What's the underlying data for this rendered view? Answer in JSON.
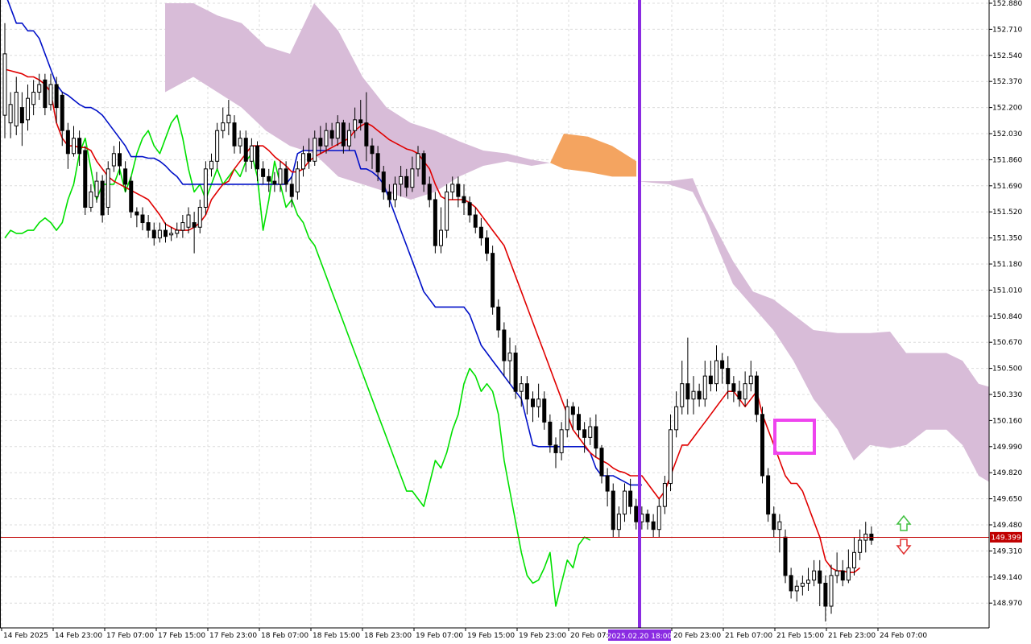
{
  "chart_data": {
    "type": "candlestick",
    "instrument_timeframe": "H2",
    "grid": true,
    "ylim": [
      148.885,
      152.88
    ],
    "y_ticks": [
      "152.880",
      "152.710",
      "152.540",
      "152.370",
      "152.200",
      "152.030",
      "151.860",
      "151.690",
      "151.520",
      "151.350",
      "151.180",
      "151.010",
      "150.840",
      "150.670",
      "150.500",
      "150.330",
      "150.160",
      "149.990",
      "149.820",
      "149.650",
      "149.480",
      "149.310",
      "149.140",
      "148.970"
    ],
    "x_ticks": [
      "14 Feb 2025",
      "14 Feb 23:00",
      "17 Feb 07:00",
      "17 Feb 15:00",
      "17 Feb 23:00",
      "18 Feb 07:00",
      "18 Feb 15:00",
      "18 Feb 23:00",
      "19 Feb 07:00",
      "19 Feb 15:00",
      "19 Feb 23:00",
      "20 Feb 07:00",
      "20 Feb 23:00",
      "21 Feb 07:00",
      "21 Feb 15:00",
      "21 Feb 23:00",
      "24 Feb 07:00"
    ],
    "current_price": "149.399",
    "vline_label": "2025.02.20 18:00",
    "colors": {
      "tenkan": "#e00000",
      "kijun": "#0010c8",
      "chikou": "#00e000",
      "cloud_bear": "#d8bcd8",
      "cloud_bull": "#f4a460",
      "vline": "#8a2be2",
      "price_line": "#c00000",
      "highlight_box": "#ee44ee",
      "arrow_up": "#40c040",
      "arrow_down": "#e03030"
    },
    "candles": [
      [
        152.15,
        152.55,
        152.0,
        152.75
      ],
      [
        152.1,
        152.22,
        152.0,
        152.3
      ],
      [
        152.08,
        152.3,
        152.02,
        152.4
      ],
      [
        152.2,
        152.1,
        151.95,
        152.3
      ],
      [
        152.12,
        152.26,
        152.05,
        152.35
      ],
      [
        152.22,
        152.3,
        152.15,
        152.38
      ],
      [
        152.3,
        152.35,
        152.25,
        152.42
      ],
      [
        152.38,
        152.2,
        152.15,
        152.42
      ],
      [
        152.22,
        152.35,
        152.18,
        152.42
      ],
      [
        152.35,
        152.2,
        152.1,
        152.4
      ],
      [
        152.28,
        152.05,
        151.95,
        152.3
      ],
      [
        152.05,
        151.9,
        151.8,
        152.1
      ],
      [
        151.9,
        152.0,
        151.88,
        152.08
      ],
      [
        152.0,
        151.9,
        151.82,
        152.05
      ],
      [
        151.92,
        151.55,
        151.5,
        151.95
      ],
      [
        151.55,
        151.65,
        151.52,
        151.7
      ],
      [
        151.62,
        151.72,
        151.58,
        151.78
      ],
      [
        151.72,
        151.5,
        151.45,
        151.76
      ],
      [
        151.55,
        151.8,
        151.5,
        151.85
      ],
      [
        151.82,
        151.9,
        151.78,
        151.95
      ],
      [
        151.9,
        151.82,
        151.76,
        151.98
      ],
      [
        151.8,
        151.7,
        151.65,
        151.85
      ],
      [
        151.72,
        151.52,
        151.48,
        151.75
      ],
      [
        151.52,
        151.5,
        151.42,
        151.55
      ],
      [
        151.5,
        151.45,
        151.4,
        151.55
      ],
      [
        151.45,
        151.4,
        151.35,
        151.5
      ],
      [
        151.4,
        151.35,
        151.3,
        151.45
      ],
      [
        151.35,
        151.4,
        151.32,
        151.45
      ],
      [
        151.4,
        151.36,
        151.32,
        151.45
      ],
      [
        151.37,
        151.38,
        151.33,
        151.42
      ],
      [
        151.38,
        151.4,
        151.35,
        151.45
      ],
      [
        151.4,
        151.45,
        151.35,
        151.5
      ],
      [
        151.42,
        151.5,
        151.38,
        151.55
      ],
      [
        151.45,
        151.42,
        151.25,
        151.52
      ],
      [
        151.42,
        151.55,
        151.38,
        151.6
      ],
      [
        151.55,
        151.8,
        151.5,
        151.85
      ],
      [
        151.8,
        151.85,
        151.75,
        151.9
      ],
      [
        151.85,
        152.05,
        151.8,
        152.1
      ],
      [
        152.05,
        152.1,
        152.0,
        152.2
      ],
      [
        152.1,
        152.15,
        152.02,
        152.25
      ],
      [
        152.1,
        151.95,
        151.9,
        152.15
      ],
      [
        151.95,
        152.0,
        151.9,
        152.05
      ],
      [
        152.0,
        151.85,
        151.78,
        152.05
      ],
      [
        151.85,
        151.95,
        151.8,
        152.0
      ],
      [
        151.95,
        151.8,
        151.72,
        151.98
      ],
      [
        151.8,
        151.75,
        151.7,
        151.85
      ],
      [
        151.75,
        151.72,
        151.65,
        151.8
      ],
      [
        151.72,
        151.7,
        151.65,
        151.78
      ],
      [
        151.7,
        151.8,
        151.65,
        151.85
      ],
      [
        151.8,
        151.7,
        151.65,
        151.85
      ],
      [
        151.7,
        151.62,
        151.55,
        151.75
      ],
      [
        151.65,
        151.8,
        151.6,
        151.85
      ],
      [
        151.8,
        151.9,
        151.75,
        151.95
      ],
      [
        151.9,
        151.85,
        151.8,
        152.0
      ],
      [
        151.85,
        152.0,
        151.82,
        152.05
      ],
      [
        152.0,
        151.95,
        151.9,
        152.08
      ],
      [
        151.95,
        152.05,
        151.9,
        152.1
      ],
      [
        152.05,
        152.0,
        151.95,
        152.1
      ],
      [
        152.0,
        152.1,
        151.95,
        152.15
      ],
      [
        152.1,
        151.95,
        151.9,
        152.12
      ],
      [
        151.95,
        152.05,
        151.92,
        152.1
      ],
      [
        152.05,
        152.12,
        152.0,
        152.2
      ],
      [
        152.12,
        152.1,
        152.05,
        152.25
      ],
      [
        152.1,
        151.95,
        151.85,
        152.3
      ],
      [
        151.95,
        151.9,
        151.8,
        152.0
      ],
      [
        151.9,
        151.78,
        151.72,
        151.95
      ],
      [
        151.78,
        151.65,
        151.6,
        151.82
      ],
      [
        151.65,
        151.6,
        151.55,
        151.7
      ],
      [
        151.6,
        151.7,
        151.55,
        151.75
      ],
      [
        151.7,
        151.75,
        151.62,
        151.82
      ],
      [
        151.75,
        151.68,
        151.62,
        151.8
      ],
      [
        151.68,
        151.8,
        151.65,
        151.88
      ],
      [
        151.8,
        151.9,
        151.75,
        151.95
      ],
      [
        151.9,
        151.7,
        151.65,
        151.92
      ],
      [
        151.7,
        151.6,
        151.55,
        151.75
      ],
      [
        151.6,
        151.3,
        151.25,
        151.65
      ],
      [
        151.3,
        151.4,
        151.25,
        151.55
      ],
      [
        151.4,
        151.65,
        151.35,
        151.7
      ],
      [
        151.65,
        151.7,
        151.6,
        151.75
      ],
      [
        151.7,
        151.62,
        151.55,
        151.75
      ],
      [
        151.62,
        151.58,
        151.5,
        151.7
      ],
      [
        151.58,
        151.5,
        151.45,
        151.62
      ],
      [
        151.5,
        151.42,
        151.38,
        151.55
      ],
      [
        151.42,
        151.35,
        151.3,
        151.48
      ],
      [
        151.35,
        151.25,
        151.2,
        151.4
      ],
      [
        151.25,
        150.9,
        150.85,
        151.3
      ],
      [
        150.9,
        150.75,
        150.7,
        150.95
      ],
      [
        150.75,
        150.55,
        150.45,
        150.8
      ],
      [
        150.55,
        150.6,
        150.4,
        150.7
      ],
      [
        150.6,
        150.35,
        150.3,
        150.65
      ],
      [
        150.35,
        150.4,
        150.25,
        150.45
      ],
      [
        150.4,
        150.3,
        150.2,
        150.45
      ],
      [
        150.3,
        150.25,
        150.15,
        150.35
      ],
      [
        150.25,
        150.3,
        150.18,
        150.4
      ],
      [
        150.3,
        150.15,
        150.1,
        150.35
      ],
      [
        150.15,
        150.0,
        149.95,
        150.2
      ],
      [
        150.0,
        149.95,
        149.85,
        150.05
      ],
      [
        149.95,
        150.1,
        149.9,
        150.15
      ],
      [
        150.1,
        150.25,
        150.05,
        150.3
      ],
      [
        150.25,
        150.2,
        150.1,
        150.28
      ],
      [
        150.2,
        150.1,
        150.05,
        150.25
      ],
      [
        150.1,
        150.05,
        149.95,
        150.15
      ],
      [
        150.05,
        150.12,
        150.0,
        150.18
      ],
      [
        150.12,
        149.98,
        149.92,
        150.2
      ],
      [
        149.98,
        149.8,
        149.75,
        150.0
      ],
      [
        149.8,
        149.7,
        149.6,
        149.85
      ],
      [
        149.7,
        149.45,
        149.4,
        149.75
      ],
      [
        149.45,
        149.55,
        149.4,
        149.6
      ],
      [
        149.55,
        149.7,
        149.5,
        149.75
      ],
      [
        149.7,
        149.6,
        149.55,
        149.78
      ],
      [
        149.6,
        149.5,
        149.45,
        149.65
      ],
      [
        149.5,
        149.55,
        149.45,
        149.6
      ],
      [
        149.55,
        149.5,
        149.45,
        149.58
      ],
      [
        149.5,
        149.45,
        149.4,
        149.55
      ],
      [
        149.45,
        149.6,
        149.4,
        149.65
      ],
      [
        149.6,
        149.75,
        149.55,
        149.8
      ],
      [
        149.75,
        150.1,
        149.7,
        150.2
      ],
      [
        150.1,
        150.25,
        150.05,
        150.35
      ],
      [
        150.25,
        150.4,
        150.2,
        150.55
      ],
      [
        150.4,
        150.3,
        150.2,
        150.7
      ],
      [
        150.3,
        150.35,
        150.2,
        150.45
      ],
      [
        150.35,
        150.3,
        150.25,
        150.4
      ],
      [
        150.3,
        150.45,
        150.25,
        150.55
      ],
      [
        150.45,
        150.4,
        150.35,
        150.55
      ],
      [
        150.4,
        150.55,
        150.35,
        150.65
      ],
      [
        150.55,
        150.5,
        150.4,
        150.6
      ],
      [
        150.5,
        150.4,
        150.3,
        150.58
      ],
      [
        150.4,
        150.35,
        150.28,
        150.45
      ],
      [
        150.35,
        150.3,
        150.25,
        150.42
      ],
      [
        150.3,
        150.4,
        150.25,
        150.48
      ],
      [
        150.4,
        150.45,
        150.35,
        150.55
      ],
      [
        150.45,
        150.2,
        150.15,
        150.48
      ],
      [
        150.2,
        149.8,
        149.75,
        150.25
      ],
      [
        149.8,
        149.55,
        149.5,
        149.85
      ],
      [
        149.55,
        149.45,
        149.4,
        149.6
      ],
      [
        149.45,
        149.5,
        149.3,
        149.55
      ],
      [
        149.4,
        149.15,
        149.1,
        149.45
      ],
      [
        149.15,
        149.05,
        149.0,
        149.2
      ],
      [
        149.05,
        149.08,
        148.98,
        149.12
      ],
      [
        149.08,
        149.1,
        149.02,
        149.15
      ],
      [
        149.1,
        149.12,
        149.05,
        149.2
      ],
      [
        149.12,
        149.18,
        149.08,
        149.25
      ],
      [
        149.18,
        149.1,
        148.95,
        149.25
      ],
      [
        149.1,
        148.95,
        148.85,
        149.15
      ],
      [
        148.95,
        149.15,
        148.9,
        149.22
      ],
      [
        149.15,
        149.18,
        149.1,
        149.3
      ],
      [
        149.18,
        149.12,
        149.08,
        149.25
      ],
      [
        149.12,
        149.2,
        149.1,
        149.32
      ],
      [
        149.2,
        149.3,
        149.15,
        149.4
      ],
      [
        149.3,
        149.38,
        149.25,
        149.45
      ],
      [
        149.38,
        149.42,
        149.3,
        149.5
      ],
      [
        149.42,
        149.38,
        149.35,
        149.47
      ]
    ],
    "tenkan": [
      152.45,
      152.44,
      152.43,
      152.42,
      152.4,
      152.4,
      152.38,
      152.35,
      152.3,
      152.1,
      152.0,
      151.95,
      151.95,
      151.94,
      151.94,
      151.92,
      151.85,
      151.8,
      151.75,
      151.72,
      151.7,
      151.68,
      151.66,
      151.64,
      151.62,
      151.6,
      151.55,
      151.5,
      151.44,
      151.42,
      151.4,
      151.4,
      151.4,
      151.42,
      151.45,
      151.5,
      151.6,
      151.65,
      151.7,
      151.72,
      151.8,
      151.85,
      151.9,
      151.95,
      151.95,
      151.95,
      151.92,
      151.88,
      151.85,
      151.82,
      151.78,
      151.78,
      151.8,
      151.85,
      151.88,
      151.9,
      151.92,
      151.94,
      151.96,
      151.98,
      152.0,
      152.05,
      152.08,
      152.1,
      152.08,
      152.05,
      152.02,
      151.99,
      151.97,
      151.95,
      151.93,
      151.92,
      151.9,
      151.85,
      151.8,
      151.7,
      151.62,
      151.6,
      151.6,
      151.6,
      151.6,
      151.58,
      151.55,
      151.5,
      151.45,
      151.4,
      151.35,
      151.3,
      151.2,
      151.1,
      151.0,
      150.9,
      150.8,
      150.7,
      150.6,
      150.5,
      150.4,
      150.3,
      150.2,
      150.1,
      150.05,
      150.0,
      149.95,
      149.92,
      149.9,
      149.88,
      149.85,
      149.83,
      149.82,
      149.8,
      149.8,
      149.8,
      149.75,
      149.7,
      149.65,
      149.7,
      149.8,
      149.9,
      150.0,
      150.0,
      150.05,
      150.1,
      150.15,
      150.2,
      150.25,
      150.3,
      150.35,
      150.35,
      150.3,
      150.25,
      150.3,
      150.35,
      150.2,
      150.1,
      150.0,
      149.9,
      149.8,
      149.75,
      149.75,
      149.7,
      149.6,
      149.5,
      149.4,
      149.25,
      149.2,
      149.18,
      149.18,
      149.17,
      149.17,
      149.2
    ],
    "kijun": [
      152.95,
      152.85,
      152.75,
      152.75,
      152.7,
      152.7,
      152.65,
      152.55,
      152.45,
      152.35,
      152.3,
      152.28,
      152.25,
      152.22,
      152.2,
      152.2,
      152.18,
      152.15,
      152.1,
      152.05,
      152.0,
      151.95,
      151.88,
      151.88,
      151.88,
      151.87,
      151.87,
      151.85,
      151.82,
      151.78,
      151.75,
      151.7,
      151.7,
      151.7,
      151.7,
      151.7,
      151.7,
      151.7,
      151.7,
      151.7,
      151.7,
      151.7,
      151.7,
      151.7,
      151.7,
      151.7,
      151.7,
      151.7,
      151.7,
      151.7,
      151.75,
      151.9,
      151.92,
      151.92,
      151.92,
      151.92,
      151.92,
      151.92,
      151.92,
      151.92,
      151.92,
      151.92,
      151.8,
      151.8,
      151.78,
      151.75,
      151.7,
      151.6,
      151.5,
      151.4,
      151.3,
      151.2,
      151.1,
      151.0,
      150.95,
      150.9,
      150.9,
      150.9,
      150.9,
      150.9,
      150.9,
      150.85,
      150.75,
      150.65,
      150.6,
      150.55,
      150.5,
      150.45,
      150.4,
      150.35,
      150.3,
      150.15,
      150.0,
      149.99,
      149.99,
      149.99,
      149.99,
      149.99,
      149.99,
      149.99,
      149.99,
      149.99,
      149.95,
      149.85,
      149.8,
      149.8,
      149.8,
      149.78,
      149.76,
      149.74,
      149.74,
      149.74
    ],
    "chikou": [
      151.35,
      151.4,
      151.38,
      151.38,
      151.4,
      151.4,
      151.45,
      151.48,
      151.45,
      151.4,
      151.45,
      151.6,
      151.7,
      151.9,
      152.0,
      151.8,
      151.6,
      151.7,
      151.7,
      151.7,
      151.8,
      151.65,
      151.75,
      151.9,
      152.0,
      152.05,
      151.95,
      151.9,
      152.0,
      152.1,
      152.15,
      152.0,
      151.8,
      151.65,
      151.7,
      151.6,
      151.7,
      151.8,
      151.7,
      151.75,
      151.8,
      151.75,
      151.85,
      151.9,
      151.75,
      151.4,
      151.6,
      151.85,
      151.7,
      151.55,
      151.6,
      151.5,
      151.45,
      151.35,
      151.3,
      151.2,
      151.1,
      151.0,
      150.9,
      150.8,
      150.7,
      150.6,
      150.5,
      150.4,
      150.3,
      150.2,
      150.1,
      150.0,
      149.9,
      149.8,
      149.7,
      149.7,
      149.65,
      149.6,
      149.75,
      149.9,
      149.85,
      149.95,
      150.1,
      150.2,
      150.4,
      150.5,
      150.45,
      150.35,
      150.4,
      150.35,
      150.2,
      149.9,
      149.7,
      149.5,
      149.3,
      149.15,
      149.1,
      149.12,
      149.2,
      149.3,
      148.95,
      149.1,
      149.25,
      149.2,
      149.35,
      149.4,
      149.38
    ]
  }
}
